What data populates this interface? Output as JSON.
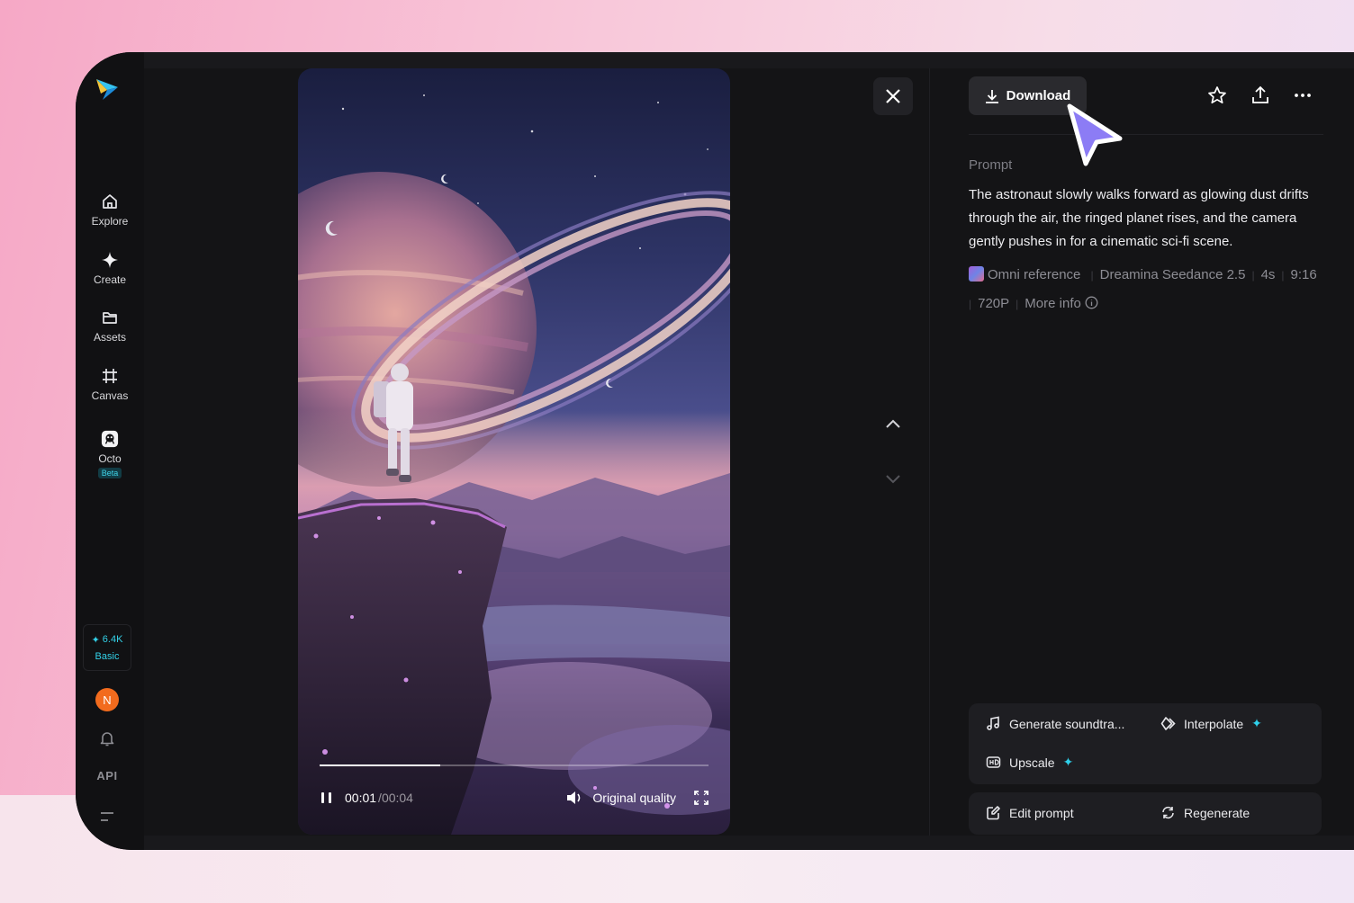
{
  "sidebar": {
    "items": [
      {
        "label": "Explore",
        "icon": "home-icon"
      },
      {
        "label": "Create",
        "icon": "sparkle-icon"
      },
      {
        "label": "Assets",
        "icon": "folder-icon"
      },
      {
        "label": "Canvas",
        "icon": "canvas-icon"
      },
      {
        "label": "Octo",
        "icon": "octo-icon",
        "badge": "Beta"
      }
    ],
    "credits": {
      "amount": "6.4K",
      "plan": "Basic"
    },
    "avatar_initial": "N",
    "api_label": "API"
  },
  "video": {
    "time_current": "00:01",
    "time_separator": "/",
    "time_total": "00:04",
    "quality": "Original quality",
    "progress": 0.31
  },
  "panel": {
    "download_label": "Download",
    "prompt_label": "Prompt",
    "prompt_text": "The astronaut slowly walks forward as glowing dust drifts through the air, the ringed planet rises, and the camera gently pushes in for a cinematic sci-fi scene.",
    "meta": {
      "reference": "Omni reference",
      "model": "Dreamina Seedance 2.5",
      "duration": "4s",
      "ratio": "9:16",
      "resolution": "720P",
      "more_info": "More info"
    },
    "tools": {
      "soundtrack": "Generate soundtra...",
      "interpolate": "Interpolate",
      "upscale": "Upscale"
    },
    "actions": {
      "edit_prompt": "Edit prompt",
      "regenerate": "Regenerate"
    }
  },
  "colors": {
    "accent": "#2fd0ea",
    "avatar": "#f26b1d",
    "cursor": "#8c7cf5"
  }
}
